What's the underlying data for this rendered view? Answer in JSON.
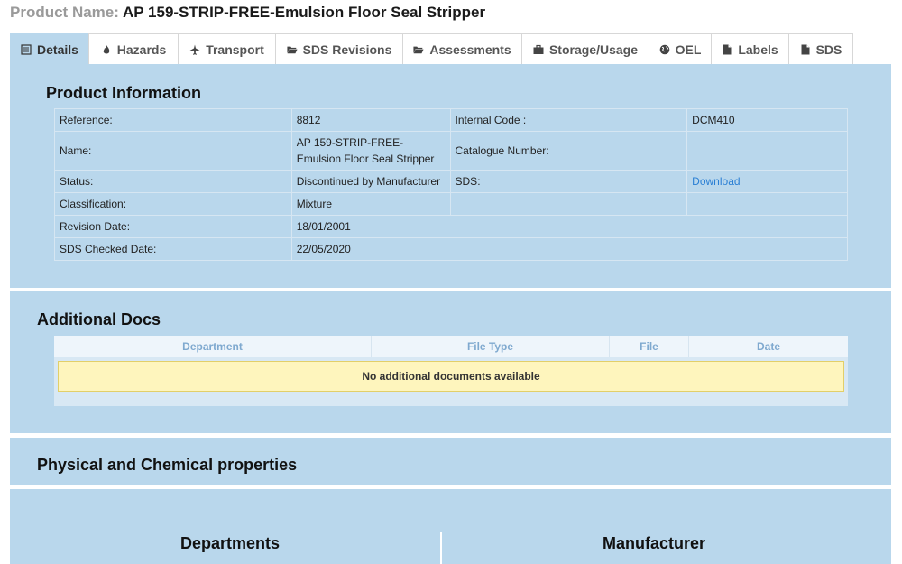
{
  "header": {
    "label": "Product Name:",
    "value": "AP 159-STRIP-FREE-Emulsion Floor Seal Stripper"
  },
  "tabs": [
    {
      "label": "Details",
      "icon": "list-icon",
      "active": true
    },
    {
      "label": "Hazards",
      "icon": "fire-icon"
    },
    {
      "label": "Transport",
      "icon": "plane-icon"
    },
    {
      "label": "SDS Revisions",
      "icon": "folder-open-icon"
    },
    {
      "label": "Assessments",
      "icon": "folder-open-icon"
    },
    {
      "label": "Storage/Usage",
      "icon": "briefcase-icon"
    },
    {
      "label": "OEL",
      "icon": "globe-icon"
    },
    {
      "label": "Labels",
      "icon": "file-icon"
    },
    {
      "label": "SDS",
      "icon": "file-icon"
    }
  ],
  "product_info": {
    "title": "Product Information",
    "reference_label": "Reference:",
    "reference_value": "8812",
    "internal_code_label": "Internal Code :",
    "internal_code_value": "DCM410",
    "name_label": "Name:",
    "name_value": "AP 159-STRIP-FREE-Emulsion Floor Seal Stripper",
    "catalogue_label": "Catalogue Number:",
    "catalogue_value": "",
    "status_label": "Status:",
    "status_value": "Discontinued by Manufacturer",
    "sds_label": "SDS:",
    "sds_link": "Download",
    "classification_label": "Classification:",
    "classification_value": "Mixture",
    "revision_date_label": "Revision Date:",
    "revision_date_value": "18/01/2001",
    "sds_checked_label": "SDS Checked Date:",
    "sds_checked_value": "22/05/2020"
  },
  "additional_docs": {
    "title": "Additional Docs",
    "columns": [
      "Department",
      "File Type",
      "File",
      "Date"
    ],
    "empty_message": "No additional documents available"
  },
  "physical": {
    "title": "Physical and Chemical properties"
  },
  "bottom": {
    "departments": "Departments",
    "manufacturer": "Manufacturer"
  }
}
